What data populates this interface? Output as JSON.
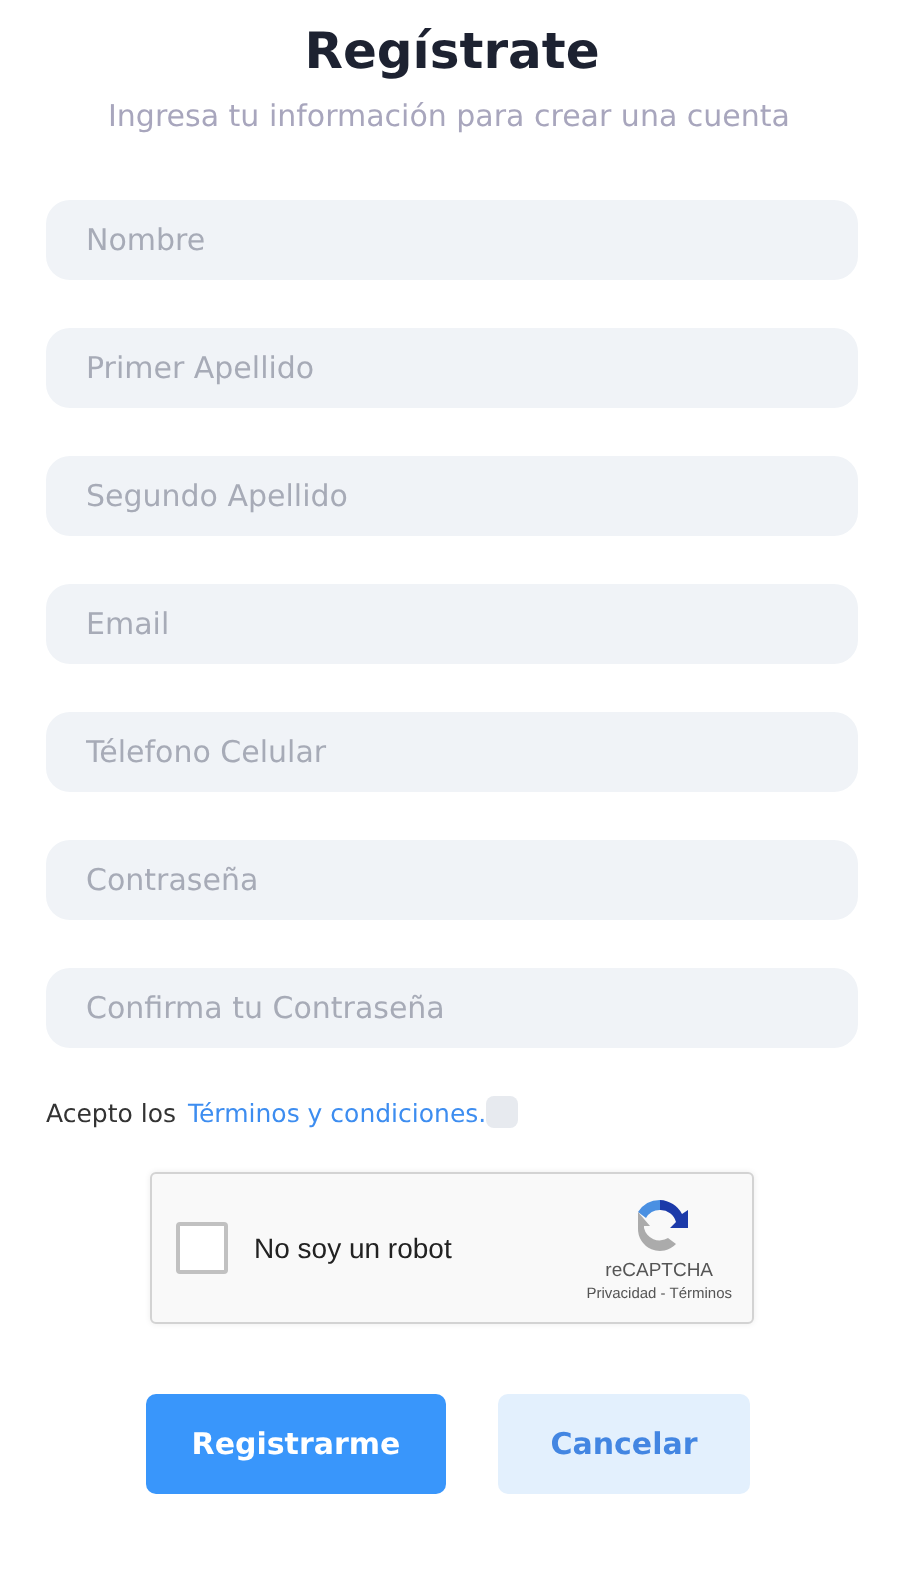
{
  "title": "Regístrate",
  "subtitle": "Ingresa tu información para crear una cuenta",
  "fields": [
    {
      "placeholder": "Nombre"
    },
    {
      "placeholder": "Primer Apellido"
    },
    {
      "placeholder": "Segundo Apellido"
    },
    {
      "placeholder": "Email"
    },
    {
      "placeholder": "Télefono Celular"
    },
    {
      "placeholder": "Contraseña"
    },
    {
      "placeholder": "Confirma tu Contraseña"
    }
  ],
  "terms": {
    "text": "Acepto los",
    "link": "Términos y condiciones.",
    "checked": false
  },
  "captcha": {
    "label": "No soy un robot",
    "checked": false,
    "brand": "reCAPTCHA",
    "links": "Privacidad - Términos"
  },
  "buttons": [
    {
      "label": "Registrarme",
      "kind": "primary"
    },
    {
      "label": "Cancelar",
      "kind": "secondary"
    }
  ]
}
